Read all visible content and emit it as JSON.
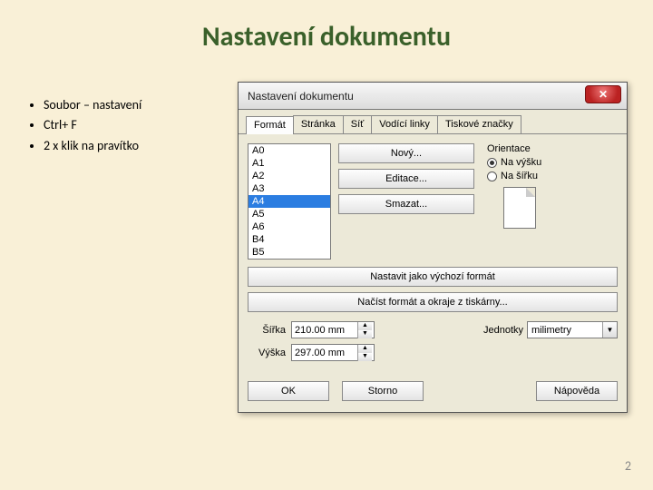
{
  "slide": {
    "title": "Nastavení dokumentu",
    "bullets": [
      "Soubor – nastavení",
      "Ctrl+ F",
      "2 x klik na pravítko"
    ],
    "page_number": "2"
  },
  "dialog": {
    "title": "Nastavení dokumentu",
    "close": "✕",
    "tabs": [
      "Formát",
      "Stránka",
      "Síť",
      "Vodící linky",
      "Tiskové značky"
    ],
    "active_tab": 0,
    "formats": [
      "A0",
      "A1",
      "A2",
      "A3",
      "A4",
      "A5",
      "A6",
      "B4",
      "B5"
    ],
    "selected_format": "A4",
    "buttons": {
      "new": "Nový...",
      "edit": "Editace...",
      "delete": "Smazat...",
      "set_default": "Nastavit jako výchozí formát",
      "load_printer": "Načíst formát a okraje z tiskárny..."
    },
    "orientation": {
      "label": "Orientace",
      "portrait": "Na výšku",
      "landscape": "Na šířku",
      "selected": "portrait"
    },
    "dims": {
      "width_label": "Šířka",
      "width_value": "210.00 mm",
      "height_label": "Výška",
      "height_value": "297.00 mm"
    },
    "units": {
      "label": "Jednotky",
      "value": "milimetry"
    },
    "footer": {
      "ok": "OK",
      "cancel": "Storno",
      "help": "Nápověda"
    }
  }
}
